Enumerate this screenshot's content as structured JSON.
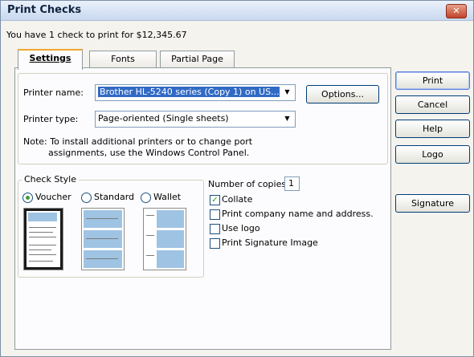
{
  "window": {
    "title": "Print Checks",
    "close_glyph": "✕"
  },
  "summary": "You have 1 check to print for $12,345.67",
  "tabs": [
    {
      "label": "Settings"
    },
    {
      "label": "Fonts"
    },
    {
      "label": "Partial Page"
    }
  ],
  "printer": {
    "name_label": "Printer name:",
    "name_value": "Brother HL-5240 series (Copy 1) on US...",
    "type_label": "Printer type:",
    "type_value": "Page-oriented (Single sheets)",
    "options_label": "Options...",
    "note_line1": "Note: To install additional printers or to change port",
    "note_line2": "assignments, use the Windows Control Panel."
  },
  "check_style": {
    "legend": "Check Style",
    "options": [
      {
        "label": "Voucher",
        "selected": true
      },
      {
        "label": "Standard",
        "selected": false
      },
      {
        "label": "Wallet",
        "selected": false
      }
    ]
  },
  "copies": {
    "label": "Number of copies:",
    "value": "1"
  },
  "checkboxes": [
    {
      "label": "Collate",
      "checked": true
    },
    {
      "label": "Print company name and address.",
      "checked": false
    },
    {
      "label": "Use logo",
      "checked": false
    },
    {
      "label": "Print Signature Image",
      "checked": false
    }
  ],
  "buttons": {
    "print": "Print",
    "cancel": "Cancel",
    "help": "Help",
    "logo": "Logo",
    "signature": "Signature"
  },
  "icons": {
    "dropdown_arrow": "▼",
    "check_mark": "✓",
    "close": "close-icon"
  }
}
